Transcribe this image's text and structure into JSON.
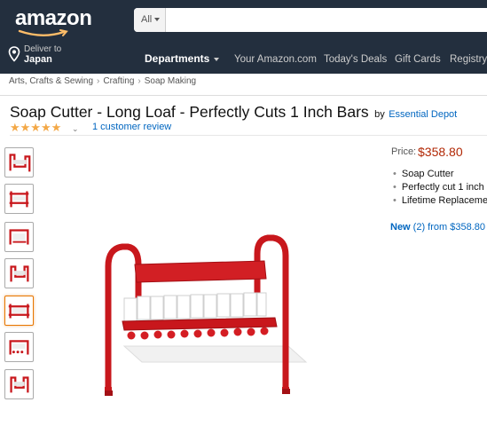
{
  "header": {
    "logo_text": "amazon",
    "search": {
      "category": "All",
      "placeholder": ""
    },
    "deliver_to": {
      "line1": "Deliver to",
      "line2": "Japan"
    },
    "departments_label": "Departments",
    "nav_links": [
      "Your Amazon.com",
      "Today's Deals",
      "Gift Cards",
      "Registry"
    ]
  },
  "breadcrumbs": [
    "Arts, Crafts & Sewing",
    "Crafting",
    "Soap Making"
  ],
  "product": {
    "title": "Soap Cutter - Long Loaf - Perfectly Cuts 1 Inch Bars",
    "by": "by",
    "brand": "Essential Depot",
    "stars": "★★★★★",
    "rating_caret": "⌄",
    "reviews": "1 customer review"
  },
  "buy_box": {
    "price_label": "Price:",
    "price": "$358.80",
    "features": [
      "Soap Cutter",
      "Perfectly cut 1 inch",
      "Lifetime Replaceme"
    ],
    "new_offer_prefix": "New",
    "new_offer_rest": " (2) from $358.80"
  },
  "colors": {
    "nav_bg": "#232f3e",
    "accent_orange": "#febd69",
    "link": "#0066c0",
    "price": "#b12704",
    "stars": "#f3a847",
    "product_red": "#c8171c"
  },
  "icons": {
    "location": "location-pin-icon",
    "caret": "chevron-down-icon"
  }
}
